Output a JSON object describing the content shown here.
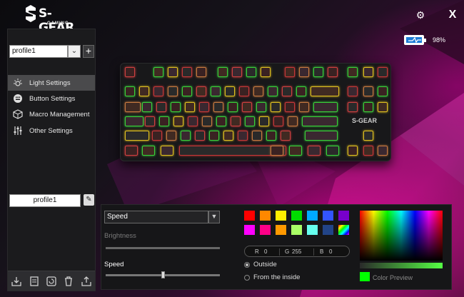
{
  "brand": {
    "name": "S-GEAR",
    "sub": "GAMING"
  },
  "window": {
    "battery_pct": "98%"
  },
  "sidebar": {
    "profile_select_value": "profile1",
    "items": [
      {
        "label": "Light Settings",
        "icon": "sun-icon",
        "active": true
      },
      {
        "label": "Button Settings",
        "icon": "keyboard-icon",
        "active": false
      },
      {
        "label": "Macro Management",
        "icon": "cube-icon",
        "active": false
      },
      {
        "label": "Other Settings",
        "icon": "sliders-icon",
        "active": false
      }
    ],
    "profile_name": "profile1",
    "tools": [
      "import-icon",
      "document-icon",
      "reset-icon",
      "trash-icon",
      "export-icon"
    ]
  },
  "keyboard": {
    "logo": "S-GEAR"
  },
  "light_panel": {
    "effect": "Speed",
    "brightness_label": "Brightness",
    "speed_label": "Speed",
    "speed_level": 0.5,
    "swatches": [
      "#ff0000",
      "#ff8800",
      "#ffee00",
      "#00dd00",
      "#00aaff",
      "#3355ff",
      "#7700cc",
      "#ff00ff",
      "#ff0088",
      "#ff9900",
      "#aaff66",
      "#66ffee",
      "#224488",
      "rainbow"
    ],
    "rgb": {
      "r_label": "R",
      "r": "0",
      "g_label": "G",
      "g": "255",
      "b_label": "B",
      "b": "0"
    },
    "radio_outside": "Outside",
    "radio_inside": "From the inside",
    "preview_label": "Color Preview",
    "preview_color": "#00ff00"
  }
}
